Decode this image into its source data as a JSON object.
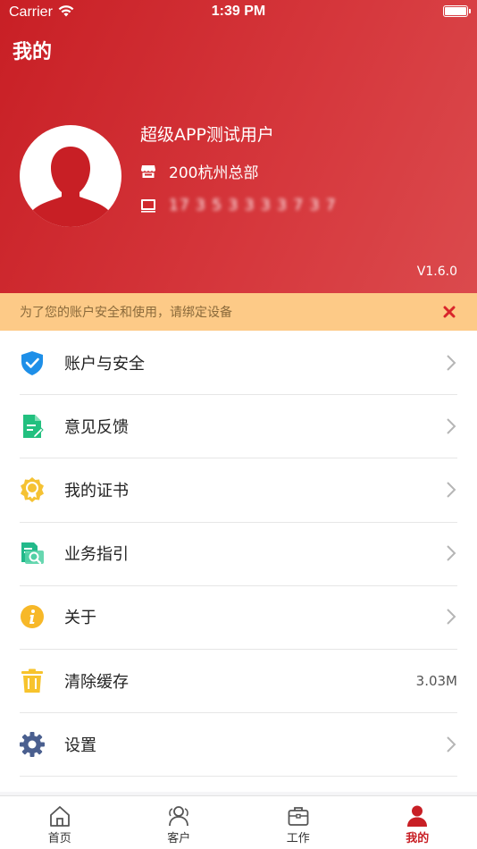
{
  "status_bar": {
    "carrier": "Carrier",
    "time": "1:39 PM"
  },
  "header": {
    "title": "我的",
    "user_name": "超级APP测试用户",
    "organization": "200杭州总部",
    "phone": "17 3 5 3 3 3 3 7 3 7",
    "version": "V1.6.0",
    "background_color": "#c81f25"
  },
  "notice": {
    "text": "为了您的账户安全和使用，请绑定设备",
    "background_color": "#fdca87"
  },
  "menu": {
    "items": [
      {
        "label": "账户与安全",
        "icon": "shield-check-icon",
        "color": "#1e8fe8"
      },
      {
        "label": "意见反馈",
        "icon": "feedback-doc-icon",
        "color": "#22c07f"
      },
      {
        "label": "我的证书",
        "icon": "certificate-badge-icon",
        "color": "#f5c233"
      },
      {
        "label": "业务指引",
        "icon": "guide-search-icon",
        "color": "#22b98a"
      },
      {
        "label": "关于",
        "icon": "info-icon",
        "color": "#f7b828"
      },
      {
        "label": "清除缓存",
        "icon": "trash-icon",
        "color": "#f7c32c",
        "value": "3.03M"
      },
      {
        "label": "设置",
        "icon": "gear-icon",
        "color": "#4a5f8f"
      }
    ]
  },
  "tabbar": {
    "items": [
      {
        "label": "首页",
        "icon": "home-icon"
      },
      {
        "label": "客户",
        "icon": "customers-icon"
      },
      {
        "label": "工作",
        "icon": "briefcase-icon"
      },
      {
        "label": "我的",
        "icon": "person-icon",
        "active": true
      }
    ],
    "active_color": "#c81f25"
  }
}
